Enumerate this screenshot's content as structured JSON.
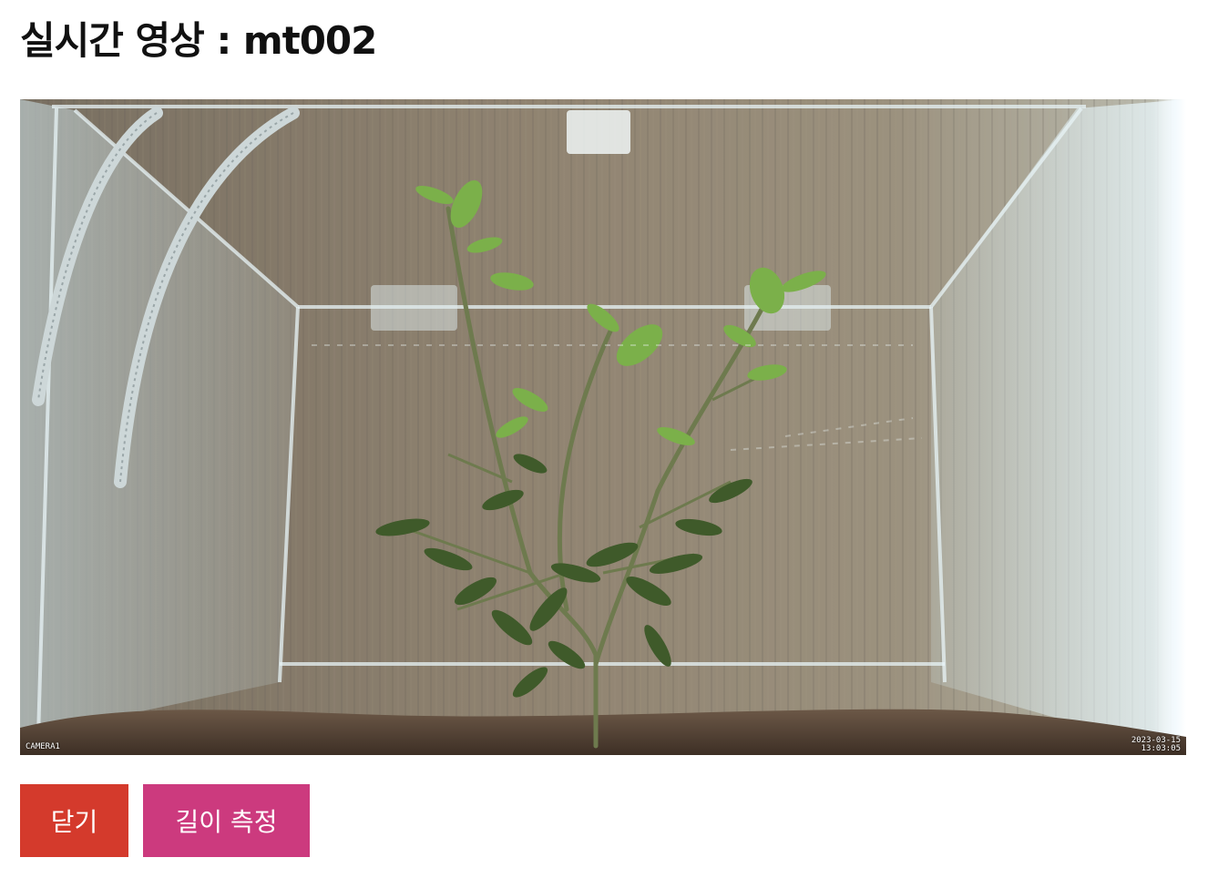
{
  "page": {
    "title": "실시간 영상 : mt002"
  },
  "video": {
    "osd_left": "CAMERA1",
    "osd_right_line1": "2023-03-15",
    "osd_right_line2": "13:03:05"
  },
  "buttons": {
    "close_label": "닫기",
    "measure_label": "길이 측정"
  },
  "colors": {
    "close_button": "#d43a2c",
    "measure_button": "#cc3a7e"
  }
}
